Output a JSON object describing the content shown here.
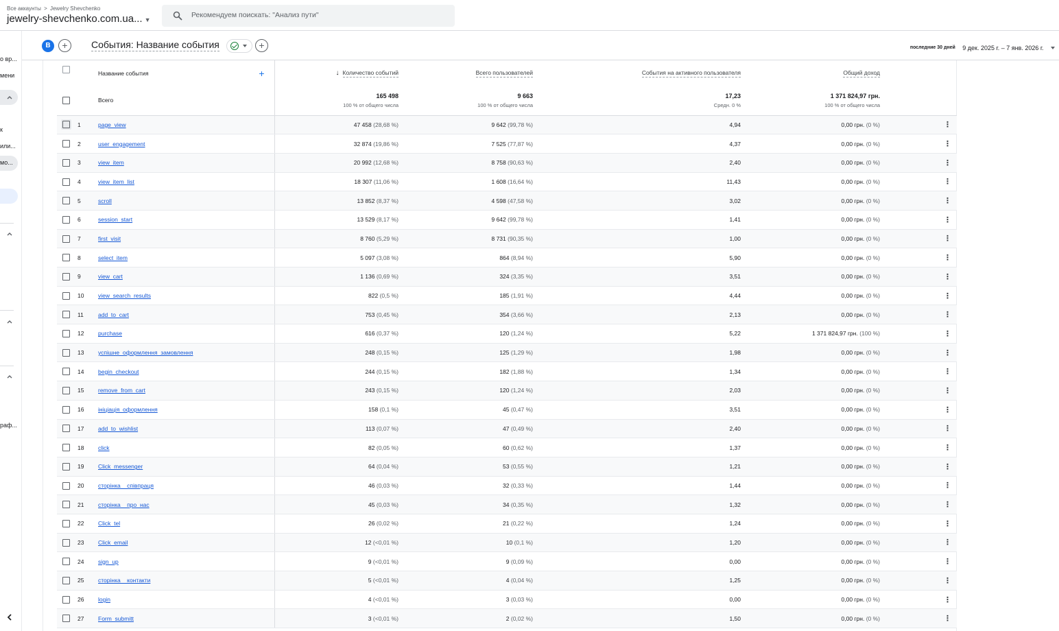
{
  "topbar": {
    "crumb_all": "Все аккаунты",
    "crumb_account": "Jewelry Shevchenko",
    "property": "jewelry-shevchenko.com.ua...",
    "search_placeholder": "Рекомендуем поискать: \"Анализ пути\""
  },
  "rail": {
    "items": [
      "о вр...",
      "мени",
      "к",
      "или...",
      "мо...",
      "раф..."
    ]
  },
  "header": {
    "avatar_letter": "B",
    "title": "События: Название события",
    "date_label": "последние 30 дней",
    "date_value": "9 дек. 2025 г. – 7 янв. 2026 г."
  },
  "table": {
    "columns": {
      "name": "Название события",
      "count": "Количество событий",
      "users": "Всего пользователей",
      "per_user": "События на активного пользователя",
      "revenue": "Общий доход"
    },
    "totals": {
      "label": "Всего",
      "count": "165 498",
      "count_sub": "100 % от общего числа",
      "users": "9 663",
      "users_sub": "100 % от общего числа",
      "per_user": "17,23",
      "per_user_sub": "Средн. 0 %",
      "revenue": "1 371 824,97 грн.",
      "revenue_sub": "100 % от общего числа"
    },
    "rows": [
      {
        "n": "1",
        "name": "page_view",
        "count": "47 458",
        "count_pct": "(28,68 %)",
        "users": "9 642",
        "users_pct": "(99,78 %)",
        "per_user": "4,94",
        "revenue": "0,00 грн.",
        "revenue_pct": "(0 %)"
      },
      {
        "n": "2",
        "name": "user_engagement",
        "count": "32 874",
        "count_pct": "(19,86 %)",
        "users": "7 525",
        "users_pct": "(77,87 %)",
        "per_user": "4,37",
        "revenue": "0,00 грн.",
        "revenue_pct": "(0 %)"
      },
      {
        "n": "3",
        "name": "view_item",
        "count": "20 992",
        "count_pct": "(12,68 %)",
        "users": "8 758",
        "users_pct": "(90,63 %)",
        "per_user": "2,40",
        "revenue": "0,00 грн.",
        "revenue_pct": "(0 %)"
      },
      {
        "n": "4",
        "name": "view_item_list",
        "count": "18 307",
        "count_pct": "(11,06 %)",
        "users": "1 608",
        "users_pct": "(16,64 %)",
        "per_user": "11,43",
        "revenue": "0,00 грн.",
        "revenue_pct": "(0 %)"
      },
      {
        "n": "5",
        "name": "scroll",
        "count": "13 852",
        "count_pct": "(8,37 %)",
        "users": "4 598",
        "users_pct": "(47,58 %)",
        "per_user": "3,02",
        "revenue": "0,00 грн.",
        "revenue_pct": "(0 %)"
      },
      {
        "n": "6",
        "name": "session_start",
        "count": "13 529",
        "count_pct": "(8,17 %)",
        "users": "9 642",
        "users_pct": "(99,78 %)",
        "per_user": "1,41",
        "revenue": "0,00 грн.",
        "revenue_pct": "(0 %)"
      },
      {
        "n": "7",
        "name": "first_visit",
        "count": "8 760",
        "count_pct": "(5,29 %)",
        "users": "8 731",
        "users_pct": "(90,35 %)",
        "per_user": "1,00",
        "revenue": "0,00 грн.",
        "revenue_pct": "(0 %)"
      },
      {
        "n": "8",
        "name": "select_item",
        "count": "5 097",
        "count_pct": "(3,08 %)",
        "users": "864",
        "users_pct": "(8,94 %)",
        "per_user": "5,90",
        "revenue": "0,00 грн.",
        "revenue_pct": "(0 %)"
      },
      {
        "n": "9",
        "name": "view_cart",
        "count": "1 136",
        "count_pct": "(0,69 %)",
        "users": "324",
        "users_pct": "(3,35 %)",
        "per_user": "3,51",
        "revenue": "0,00 грн.",
        "revenue_pct": "(0 %)"
      },
      {
        "n": "10",
        "name": "view_search_results",
        "count": "822",
        "count_pct": "(0,5 %)",
        "users": "185",
        "users_pct": "(1,91 %)",
        "per_user": "4,44",
        "revenue": "0,00 грн.",
        "revenue_pct": "(0 %)"
      },
      {
        "n": "11",
        "name": "add_to_cart",
        "count": "753",
        "count_pct": "(0,45 %)",
        "users": "354",
        "users_pct": "(3,66 %)",
        "per_user": "2,13",
        "revenue": "0,00 грн.",
        "revenue_pct": "(0 %)"
      },
      {
        "n": "12",
        "name": "purchase",
        "count": "616",
        "count_pct": "(0,37 %)",
        "users": "120",
        "users_pct": "(1,24 %)",
        "per_user": "5,22",
        "revenue": "1 371 824,97 грн.",
        "revenue_pct": "(100 %)"
      },
      {
        "n": "13",
        "name": "успішне_оформлення_замовлення",
        "count": "248",
        "count_pct": "(0,15 %)",
        "users": "125",
        "users_pct": "(1,29 %)",
        "per_user": "1,98",
        "revenue": "0,00 грн.",
        "revenue_pct": "(0 %)"
      },
      {
        "n": "14",
        "name": "begin_checkout",
        "count": "244",
        "count_pct": "(0,15 %)",
        "users": "182",
        "users_pct": "(1,88 %)",
        "per_user": "1,34",
        "revenue": "0,00 грн.",
        "revenue_pct": "(0 %)"
      },
      {
        "n": "15",
        "name": "remove_from_cart",
        "count": "243",
        "count_pct": "(0,15 %)",
        "users": "120",
        "users_pct": "(1,24 %)",
        "per_user": "2,03",
        "revenue": "0,00 грн.",
        "revenue_pct": "(0 %)"
      },
      {
        "n": "16",
        "name": "ініціація_оформлення",
        "count": "158",
        "count_pct": "(0,1 %)",
        "users": "45",
        "users_pct": "(0,47 %)",
        "per_user": "3,51",
        "revenue": "0,00 грн.",
        "revenue_pct": "(0 %)"
      },
      {
        "n": "17",
        "name": "add_to_wishlist",
        "count": "113",
        "count_pct": "(0,07 %)",
        "users": "47",
        "users_pct": "(0,49 %)",
        "per_user": "2,40",
        "revenue": "0,00 грн.",
        "revenue_pct": "(0 %)"
      },
      {
        "n": "18",
        "name": "click",
        "count": "82",
        "count_pct": "(0,05 %)",
        "users": "60",
        "users_pct": "(0,62 %)",
        "per_user": "1,37",
        "revenue": "0,00 грн.",
        "revenue_pct": "(0 %)"
      },
      {
        "n": "19",
        "name": "Click_messenger",
        "count": "64",
        "count_pct": "(0,04 %)",
        "users": "53",
        "users_pct": "(0,55 %)",
        "per_user": "1,21",
        "revenue": "0,00 грн.",
        "revenue_pct": "(0 %)"
      },
      {
        "n": "20",
        "name": "сторінка__співпраця",
        "count": "46",
        "count_pct": "(0,03 %)",
        "users": "32",
        "users_pct": "(0,33 %)",
        "per_user": "1,44",
        "revenue": "0,00 грн.",
        "revenue_pct": "(0 %)"
      },
      {
        "n": "21",
        "name": "сторінка__про_нас",
        "count": "45",
        "count_pct": "(0,03 %)",
        "users": "34",
        "users_pct": "(0,35 %)",
        "per_user": "1,32",
        "revenue": "0,00 грн.",
        "revenue_pct": "(0 %)"
      },
      {
        "n": "22",
        "name": "Click_tel",
        "count": "26",
        "count_pct": "(0,02 %)",
        "users": "21",
        "users_pct": "(0,22 %)",
        "per_user": "1,24",
        "revenue": "0,00 грн.",
        "revenue_pct": "(0 %)"
      },
      {
        "n": "23",
        "name": "Click_email",
        "count": "12",
        "count_pct": "(<0,01 %)",
        "users": "10",
        "users_pct": "(0,1 %)",
        "per_user": "1,20",
        "revenue": "0,00 грн.",
        "revenue_pct": "(0 %)"
      },
      {
        "n": "24",
        "name": "sign_up",
        "count": "9",
        "count_pct": "(<0,01 %)",
        "users": "9",
        "users_pct": "(0,09 %)",
        "per_user": "0,00",
        "revenue": "0,00 грн.",
        "revenue_pct": "(0 %)"
      },
      {
        "n": "25",
        "name": "сторінка__контакти",
        "count": "5",
        "count_pct": "(<0,01 %)",
        "users": "4",
        "users_pct": "(0,04 %)",
        "per_user": "1,25",
        "revenue": "0,00 грн.",
        "revenue_pct": "(0 %)"
      },
      {
        "n": "26",
        "name": "login",
        "count": "4",
        "count_pct": "(<0,01 %)",
        "users": "3",
        "users_pct": "(0,03 %)",
        "per_user": "0,00",
        "revenue": "0,00 грн.",
        "revenue_pct": "(0 %)"
      },
      {
        "n": "27",
        "name": "Form_submitt",
        "count": "3",
        "count_pct": "(<0,01 %)",
        "users": "2",
        "users_pct": "(0,02 %)",
        "per_user": "1,50",
        "revenue": "0,00 грн.",
        "revenue_pct": "(0 %)"
      }
    ]
  },
  "colors": {
    "accent": "#1a73e8",
    "link": "#1558d6",
    "check_ok": "#188038"
  },
  "icons": [
    "search-icon",
    "chevron-up-icon",
    "chevron-left-icon",
    "add-comparison-icon",
    "check-circle-icon",
    "add-tab-icon",
    "more-vert-icon",
    "sort-down-icon"
  ]
}
